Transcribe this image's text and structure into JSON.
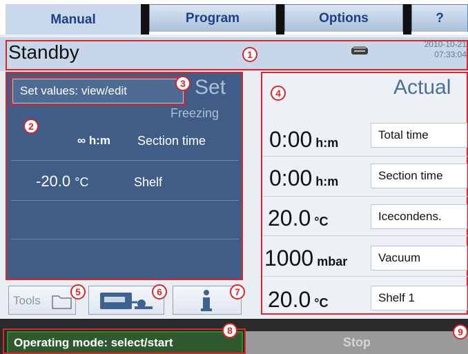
{
  "tabs": [
    {
      "label": "Manual"
    },
    {
      "label": "Program"
    },
    {
      "label": "Options"
    },
    {
      "label": "?"
    }
  ],
  "status": {
    "title": "Standby",
    "date": "2010-10-21",
    "time": "07:33:04"
  },
  "markers": [
    "1",
    "2",
    "3",
    "4",
    "5",
    "6",
    "7",
    "8",
    "9"
  ],
  "set_panel": {
    "button_label": "Set values: view/edit",
    "title": "Set",
    "subtitle": "Freezing",
    "rows": [
      {
        "value": "∞",
        "unit": "h:m",
        "label": "Section time"
      },
      {
        "value": "-20.0",
        "unit": "°C",
        "label": "Shelf"
      }
    ]
  },
  "actual_panel": {
    "title": "Actual",
    "rows": [
      {
        "value": "0:00",
        "unit": "h:m",
        "label": "Total time"
      },
      {
        "value": "0:00",
        "unit": "h:m",
        "label": "Section time"
      },
      {
        "value": "20.0",
        "unit": "°C",
        "label": "Icecondens."
      },
      {
        "value": "1000",
        "unit": "mbar",
        "label": "Vacuum"
      },
      {
        "value": "20.0",
        "unit": "°C",
        "label": "Shelf 1"
      }
    ]
  },
  "tools": {
    "tools_label": "Tools"
  },
  "bottom": {
    "operating_mode": "Operating mode: select/start",
    "stop": "Stop"
  },
  "colors": {
    "accent_red": "#d8262c",
    "panel_blue": "#3f5d86",
    "tab_text": "#1b3f8a"
  }
}
